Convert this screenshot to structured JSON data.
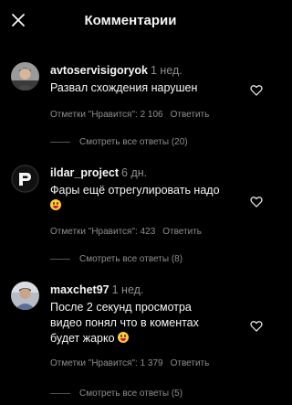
{
  "header": {
    "title": "Комментарии",
    "close_icon": "close-icon"
  },
  "comments": [
    {
      "username": "avtoservisigoryok",
      "time": "1 нед.",
      "text": "Развал схождения нарушен",
      "emoji": "",
      "likes_label": "Отметки \"Нравится\": 2 106",
      "reply_label": "Ответить",
      "view_replies": "Смотреть все ответы (20)",
      "avatar_icon": "user-avatar-photo"
    },
    {
      "username": "ildar_project",
      "time": "6 дн.",
      "text": "Фары ещё отрегулировать надо",
      "emoji": "grinning-face-emoji",
      "likes_label": "Отметки \"Нравится\": 423",
      "reply_label": "Ответить",
      "view_replies": "Смотреть все ответы (8)",
      "avatar_icon": "project-logo-avatar"
    },
    {
      "username": "maxchet97",
      "time": "1 нед.",
      "text": "После 2 секунд просмотра видео понял что в коментах будет жарко",
      "emoji": "grinning-face-emoji",
      "likes_label": "Отметки \"Нравится\": 1 379",
      "reply_label": "Ответить",
      "view_replies": "Смотреть все ответы (5)",
      "avatar_icon": "user-avatar-photo"
    }
  ],
  "colors": {
    "background": "#000000",
    "text": "#f5f5f5",
    "secondary": "#8e8e8e"
  }
}
